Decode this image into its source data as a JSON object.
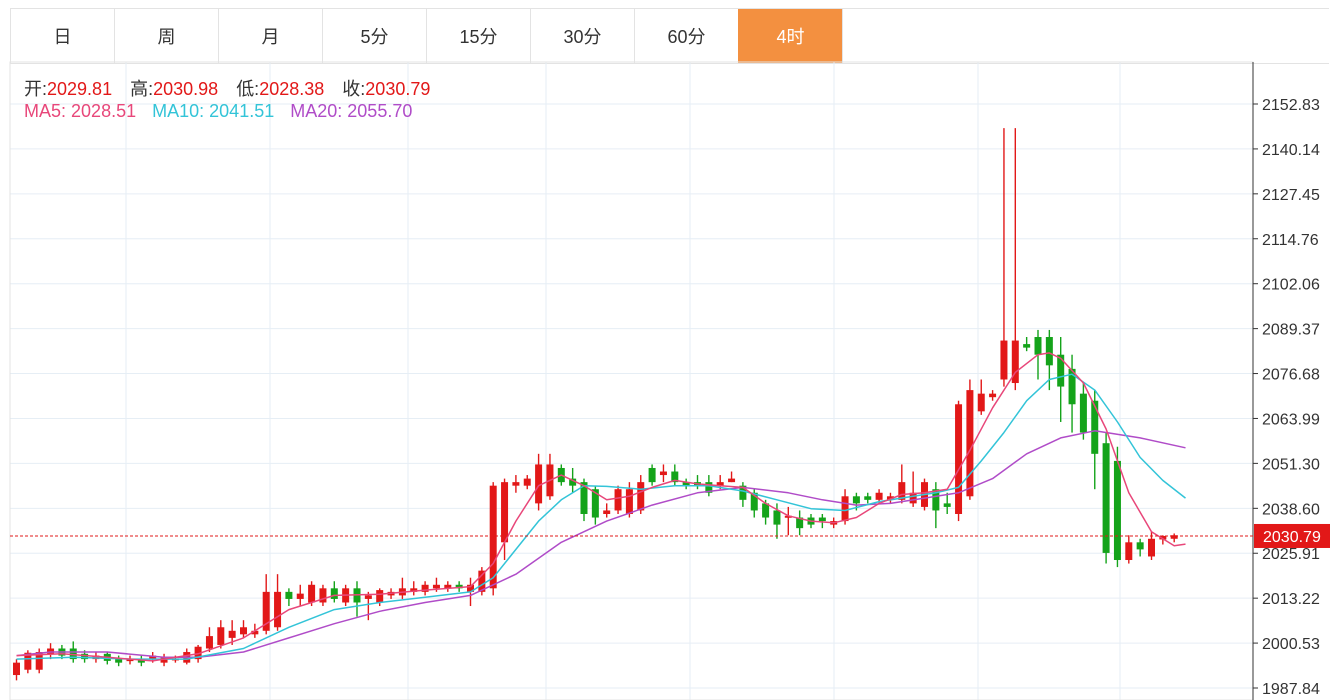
{
  "tabs": [
    {
      "label": "日"
    },
    {
      "label": "周"
    },
    {
      "label": "月"
    },
    {
      "label": "5分"
    },
    {
      "label": "15分"
    },
    {
      "label": "30分"
    },
    {
      "label": "60分"
    },
    {
      "label": "4时",
      "active": true
    }
  ],
  "ohlc": {
    "open_label": "开:",
    "open": "2029.81",
    "high_label": "高:",
    "high": "2030.98",
    "low_label": "低:",
    "low": "2028.38",
    "close_label": "收:",
    "close": "2030.79"
  },
  "ma": {
    "ma5_label": "MA5:",
    "ma5": "2028.51",
    "ma10_label": "MA10:",
    "ma10": "2041.51",
    "ma20_label": "MA20:",
    "ma20": "2055.70"
  },
  "colors": {
    "up": "#e21818",
    "down": "#14a31a",
    "ma5": "#e8477a",
    "ma10": "#33c4d8",
    "ma20": "#b04cc8",
    "grid": "#e6eef5",
    "price_line": "#e21818",
    "active_tab": "#f39040"
  },
  "chart_data": {
    "type": "candlestick",
    "y_ticks": [
      "2152.83",
      "2140.14",
      "2127.45",
      "2114.76",
      "2102.06",
      "2089.37",
      "2076.68",
      "2063.99",
      "2051.30",
      "2038.60",
      "2025.91",
      "2013.22",
      "2000.53",
      "1987.84"
    ],
    "ylim": [
      1985.0,
      2158.0
    ],
    "current_price": 2030.79,
    "current_price_label": "2030.79",
    "candles": [
      [
        1991.5,
        1995.0,
        1990.0,
        1996.0
      ],
      [
        1993.0,
        1997.8,
        1992.0,
        1998.5
      ],
      [
        1993.0,
        1998.0,
        1992.0,
        1999.0
      ],
      [
        1997.5,
        1999.0,
        1996.0,
        2000.5
      ],
      [
        1999.0,
        1997.0,
        1996.0,
        2000.0
      ],
      [
        1999.0,
        1996.0,
        1995.0,
        2001.0
      ],
      [
        1997.5,
        1996.0,
        1995.0,
        1998.5
      ],
      [
        1996.0,
        1997.0,
        1995.0,
        1998.0
      ],
      [
        1997.5,
        1995.5,
        1994.5,
        1998.0
      ],
      [
        1996.0,
        1995.0,
        1994.0,
        1997.0
      ],
      [
        1995.5,
        1996.0,
        1994.5,
        1997.0
      ],
      [
        1996.0,
        1995.0,
        1994.0,
        1997.0
      ],
      [
        1996.0,
        1997.0,
        1995.0,
        1998.0
      ],
      [
        1995.0,
        1996.5,
        1994.0,
        1997.5
      ],
      [
        1996.0,
        1996.2,
        1995.0,
        1997.0
      ],
      [
        1995.0,
        1998.0,
        1994.5,
        1999.0
      ],
      [
        1996.0,
        1999.5,
        1995.0,
        2000.0
      ],
      [
        1999.0,
        2002.5,
        1998.0,
        2005.0
      ],
      [
        2000.0,
        2005.0,
        1999.0,
        2007.0
      ],
      [
        2002.0,
        2004.0,
        2000.0,
        2007.0
      ],
      [
        2003.0,
        2005.0,
        2002.0,
        2007.0
      ],
      [
        2003.0,
        2004.0,
        2002.0,
        2006.0
      ],
      [
        2004.0,
        2015.0,
        2003.0,
        2020.0
      ],
      [
        2005.0,
        2015.0,
        2004.0,
        2020.0
      ],
      [
        2015.0,
        2013.0,
        2011.0,
        2016.0
      ],
      [
        2013.0,
        2014.5,
        2011.0,
        2017.0
      ],
      [
        2012.0,
        2017.0,
        2011.0,
        2018.0
      ],
      [
        2012.0,
        2016.0,
        2011.0,
        2017.0
      ],
      [
        2016.0,
        2013.0,
        2012.0,
        2018.0
      ],
      [
        2012.0,
        2016.0,
        2011.0,
        2017.0
      ],
      [
        2016.0,
        2012.0,
        2008.0,
        2018.0
      ],
      [
        2013.0,
        2014.0,
        2007.0,
        2015.0
      ],
      [
        2012.0,
        2015.5,
        2011.0,
        2016.0
      ],
      [
        2014.0,
        2015.0,
        2013.0,
        2016.0
      ],
      [
        2014.0,
        2016.0,
        2013.0,
        2019.0
      ],
      [
        2015.0,
        2016.0,
        2014.0,
        2018.0
      ],
      [
        2015.0,
        2017.0,
        2014.0,
        2018.0
      ],
      [
        2016.0,
        2017.0,
        2015.0,
        2019.0
      ],
      [
        2016.0,
        2017.0,
        2015.0,
        2018.0
      ],
      [
        2017.0,
        2016.0,
        2015.0,
        2018.0
      ],
      [
        2015.0,
        2017.0,
        2011.0,
        2019.0
      ],
      [
        2015.0,
        2021.0,
        2014.0,
        2022.0
      ],
      [
        2016.0,
        2045.0,
        2014.0,
        2046.0
      ],
      [
        2029.0,
        2046.0,
        2024.0,
        2047.0
      ],
      [
        2045.0,
        2046.0,
        2043.0,
        2048.0
      ],
      [
        2045.0,
        2047.0,
        2044.0,
        2048.0
      ],
      [
        2040.0,
        2051.0,
        2038.0,
        2054.0
      ],
      [
        2042.0,
        2051.0,
        2041.0,
        2054.0
      ],
      [
        2050.0,
        2046.0,
        2045.0,
        2051.0
      ],
      [
        2047.0,
        2045.0,
        2043.0,
        2050.0
      ],
      [
        2046.0,
        2037.0,
        2035.0,
        2047.0
      ],
      [
        2044.0,
        2036.0,
        2034.0,
        2045.0
      ],
      [
        2037.0,
        2038.0,
        2036.0,
        2040.0
      ],
      [
        2038.0,
        2044.0,
        2037.0,
        2045.0
      ],
      [
        2037.0,
        2044.0,
        2036.0,
        2046.0
      ],
      [
        2038.0,
        2046.0,
        2037.0,
        2048.0
      ],
      [
        2050.0,
        2046.0,
        2045.0,
        2051.0
      ],
      [
        2048.0,
        2049.0,
        2046.0,
        2051.0
      ],
      [
        2049.0,
        2046.0,
        2045.0,
        2051.0
      ],
      [
        2046.0,
        2045.0,
        2044.0,
        2047.0
      ],
      [
        2046.0,
        2045.0,
        2044.0,
        2048.0
      ],
      [
        2046.0,
        2043.0,
        2042.0,
        2048.0
      ],
      [
        2045.0,
        2046.0,
        2044.0,
        2048.0
      ],
      [
        2046.0,
        2047.0,
        2046.0,
        2049.0
      ],
      [
        2045.0,
        2041.0,
        2039.0,
        2046.0
      ],
      [
        2043.0,
        2038.0,
        2036.0,
        2044.0
      ],
      [
        2040.0,
        2036.0,
        2034.0,
        2041.0
      ],
      [
        2038.0,
        2034.0,
        2030.0,
        2040.0
      ],
      [
        2036.0,
        2036.5,
        2031.0,
        2039.0
      ],
      [
        2036.0,
        2033.0,
        2031.0,
        2038.0
      ],
      [
        2036.0,
        2034.0,
        2033.0,
        2037.0
      ],
      [
        2036.0,
        2035.0,
        2033.0,
        2037.0
      ],
      [
        2034.0,
        2035.0,
        2033.0,
        2036.0
      ],
      [
        2035.0,
        2042.0,
        2034.0,
        2044.0
      ],
      [
        2042.0,
        2040.0,
        2038.0,
        2043.0
      ],
      [
        2042.0,
        2041.0,
        2040.0,
        2043.0
      ],
      [
        2041.0,
        2043.0,
        2040.0,
        2044.0
      ],
      [
        2041.0,
        2042.0,
        2040.0,
        2043.0
      ],
      [
        2041.0,
        2046.0,
        2040.0,
        2051.0
      ],
      [
        2040.0,
        2043.0,
        2039.0,
        2049.0
      ],
      [
        2039.0,
        2046.0,
        2038.0,
        2047.0
      ],
      [
        2044.0,
        2038.0,
        2033.0,
        2046.0
      ],
      [
        2040.0,
        2039.0,
        2037.0,
        2043.0
      ],
      [
        2037.0,
        2068.0,
        2035.0,
        2069.0
      ],
      [
        2042.0,
        2072.0,
        2041.0,
        2075.0
      ],
      [
        2066.0,
        2071.0,
        2065.0,
        2075.0
      ],
      [
        2070.0,
        2071.0,
        2069.0,
        2072.0
      ],
      [
        2075.0,
        2086.0,
        2073.0,
        2146.0
      ],
      [
        2074.0,
        2086.0,
        2072.0,
        2146.0
      ],
      [
        2085.0,
        2084.0,
        2083.0,
        2087.0
      ],
      [
        2087.0,
        2082.0,
        2075.0,
        2089.0
      ],
      [
        2087.0,
        2079.0,
        2072.0,
        2089.0
      ],
      [
        2082.0,
        2073.0,
        2063.0,
        2087.0
      ],
      [
        2078.0,
        2068.0,
        2060.0,
        2082.0
      ],
      [
        2071.0,
        2060.0,
        2058.0,
        2074.0
      ],
      [
        2069.0,
        2054.0,
        2044.0,
        2072.0
      ],
      [
        2057.0,
        2026.0,
        2023.0,
        2060.0
      ],
      [
        2052.0,
        2024.0,
        2022.0,
        2056.0
      ],
      [
        2024.0,
        2029.0,
        2023.0,
        2031.0
      ],
      [
        2029.0,
        2027.0,
        2025.0,
        2030.0
      ],
      [
        2025.0,
        2030.0,
        2024.0,
        2032.0
      ],
      [
        2029.81,
        2030.79,
        2028.38,
        2030.98
      ],
      [
        2030.0,
        2031.0,
        2029.0,
        2031.5
      ]
    ],
    "ma5": [
      [
        0,
        1997.0
      ],
      [
        4,
        1997.5
      ],
      [
        8,
        1996.5
      ],
      [
        12,
        1995.5
      ],
      [
        16,
        1997.5
      ],
      [
        20,
        2002.0
      ],
      [
        22,
        2006.0
      ],
      [
        24,
        2010.0
      ],
      [
        28,
        2014.0
      ],
      [
        32,
        2014.3
      ],
      [
        36,
        2015.5
      ],
      [
        40,
        2016.5
      ],
      [
        42,
        2023.0
      ],
      [
        44,
        2035.0
      ],
      [
        46,
        2045.0
      ],
      [
        48,
        2048.0
      ],
      [
        50,
        2045.0
      ],
      [
        52,
        2041.0
      ],
      [
        54,
        2042.0
      ],
      [
        56,
        2044.5
      ],
      [
        58,
        2046.5
      ],
      [
        60,
        2045.5
      ],
      [
        62,
        2045.0
      ],
      [
        64,
        2044.5
      ],
      [
        66,
        2040.0
      ],
      [
        68,
        2036.5
      ],
      [
        70,
        2035.0
      ],
      [
        72,
        2034.5
      ],
      [
        74,
        2036.0
      ],
      [
        76,
        2040.0
      ],
      [
        78,
        2042.5
      ],
      [
        80,
        2043.0
      ],
      [
        82,
        2044.0
      ],
      [
        84,
        2055.0
      ],
      [
        86,
        2067.0
      ],
      [
        88,
        2077.0
      ],
      [
        90,
        2082.0
      ],
      [
        91,
        2082.5
      ],
      [
        92,
        2081.0
      ],
      [
        94,
        2074.0
      ],
      [
        96,
        2061.0
      ],
      [
        98,
        2043.0
      ],
      [
        100,
        2032.0
      ],
      [
        102,
        2028.0
      ],
      [
        103,
        2028.5
      ]
    ],
    "ma10": [
      [
        0,
        1996.0
      ],
      [
        5,
        1996.5
      ],
      [
        10,
        1996.0
      ],
      [
        15,
        1996.0
      ],
      [
        20,
        1999.0
      ],
      [
        24,
        2005.0
      ],
      [
        28,
        2010.0
      ],
      [
        32,
        2012.0
      ],
      [
        36,
        2013.5
      ],
      [
        40,
        2015.0
      ],
      [
        42,
        2019.0
      ],
      [
        44,
        2027.0
      ],
      [
        46,
        2035.0
      ],
      [
        48,
        2041.0
      ],
      [
        50,
        2045.0
      ],
      [
        52,
        2044.8
      ],
      [
        55,
        2044.0
      ],
      [
        58,
        2045.0
      ],
      [
        61,
        2045.0
      ],
      [
        64,
        2043.5
      ],
      [
        67,
        2041.0
      ],
      [
        70,
        2038.5
      ],
      [
        73,
        2038.0
      ],
      [
        76,
        2040.5
      ],
      [
        79,
        2042.0
      ],
      [
        81,
        2043.0
      ],
      [
        83,
        2044.5
      ],
      [
        85,
        2052.0
      ],
      [
        87,
        2060.0
      ],
      [
        89,
        2069.0
      ],
      [
        91,
        2075.0
      ],
      [
        93,
        2076.5
      ],
      [
        95,
        2072.0
      ],
      [
        97,
        2063.0
      ],
      [
        99,
        2053.0
      ],
      [
        101,
        2046.5
      ],
      [
        103,
        2041.5
      ]
    ],
    "ma20": [
      [
        0,
        1997.0
      ],
      [
        3,
        1998.0
      ],
      [
        8,
        1998.0
      ],
      [
        13,
        1996.5
      ],
      [
        16,
        1996.5
      ],
      [
        20,
        1998.0
      ],
      [
        24,
        2002.0
      ],
      [
        28,
        2006.0
      ],
      [
        32,
        2009.5
      ],
      [
        36,
        2012.0
      ],
      [
        40,
        2014.0
      ],
      [
        44,
        2020.0
      ],
      [
        48,
        2029.0
      ],
      [
        52,
        2035.0
      ],
      [
        56,
        2039.5
      ],
      [
        60,
        2043.0
      ],
      [
        64,
        2044.5
      ],
      [
        68,
        2043.0
      ],
      [
        71,
        2041.0
      ],
      [
        74,
        2039.5
      ],
      [
        77,
        2040.0
      ],
      [
        80,
        2041.5
      ],
      [
        83,
        2043.0
      ],
      [
        86,
        2047.0
      ],
      [
        89,
        2054.0
      ],
      [
        92,
        2058.5
      ],
      [
        95,
        2060.5
      ],
      [
        99,
        2058.5
      ],
      [
        103,
        2055.7
      ]
    ]
  }
}
